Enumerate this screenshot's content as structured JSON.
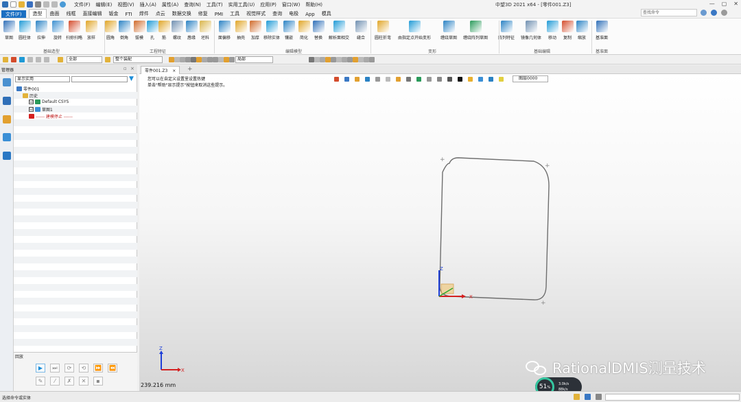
{
  "app": {
    "title": "中望3D 2021 x64 - [零件001.Z3]"
  },
  "menu": [
    "文件(F)",
    "编辑(E)",
    "视图(V)",
    "插入(A)",
    "属性(A)",
    "查询(N)",
    "工具(T)",
    "实用工具(U)",
    "应用(P)",
    "窗口(W)",
    "帮助(H)"
  ],
  "ribbon_tabs": [
    {
      "label": "文件(F)",
      "kind": "file"
    },
    {
      "label": "造型",
      "kind": "active"
    },
    {
      "label": "曲面"
    },
    {
      "label": "线框"
    },
    {
      "label": "直接编辑"
    },
    {
      "label": "钣金"
    },
    {
      "label": "FTI"
    },
    {
      "label": "焊件"
    },
    {
      "label": "点云"
    },
    {
      "label": "数据交换"
    },
    {
      "label": "修复"
    },
    {
      "label": "PMI"
    },
    {
      "label": "工具"
    },
    {
      "label": "视觉样式"
    },
    {
      "label": "查询"
    },
    {
      "label": "电极"
    },
    {
      "label": "App"
    },
    {
      "label": "模具"
    }
  ],
  "search": {
    "placeholder": "查找命令"
  },
  "ribbon": {
    "tools": [
      {
        "label": "草图",
        "color": "#2f6fb8"
      },
      {
        "label": "圆柱体",
        "color": "#1f9ad6"
      },
      {
        "label": "拉伸",
        "color": "#2a82c4"
      },
      {
        "label": "旋转",
        "color": "#3c8fd0"
      },
      {
        "label": "扫掠扫略",
        "color": "#d44c2c"
      },
      {
        "label": "放样",
        "color": "#e0a526"
      },
      {
        "label": "圆角",
        "color": "#e0a526"
      },
      {
        "label": "倒角",
        "color": "#2a82c4"
      },
      {
        "label": "拔模",
        "color": "#d06a2a"
      },
      {
        "label": "孔",
        "color": "#1f9ad6"
      },
      {
        "label": "筋",
        "color": "#e0a526"
      },
      {
        "label": "螺纹",
        "color": "#6f8fb0"
      },
      {
        "label": "唇缘",
        "color": "#2a82c4"
      },
      {
        "label": "坯料",
        "color": "#d9b54a"
      },
      {
        "label": "面偏移",
        "color": "#2a82c4"
      },
      {
        "label": "抽壳",
        "color": "#e0a526"
      },
      {
        "label": "加厚",
        "color": "#d06a2a"
      },
      {
        "label": "移除实体",
        "color": "#1f9ad6"
      },
      {
        "label": "镶嵌",
        "color": "#2a82c4"
      },
      {
        "label": "简化",
        "color": "#e0a526"
      },
      {
        "label": "替换",
        "color": "#2f6fb8"
      },
      {
        "label": "解析面相交",
        "color": "#1f9ad6"
      },
      {
        "label": "缝合",
        "color": "#6f8fb0"
      },
      {
        "label": "圆柱折弯",
        "color": "#e0a526"
      },
      {
        "label": "由指定点开始变形",
        "color": "#1f9ad6"
      },
      {
        "label": "缠绕草图",
        "color": "#2a82c4"
      },
      {
        "label": "缠绕阵列草图",
        "color": "#2a9a5a"
      },
      {
        "label": "阵列特征",
        "color": "#2a82c4"
      },
      {
        "label": "镜像几何体",
        "color": "#6f8fb0"
      },
      {
        "label": "移动",
        "color": "#1f9ad6"
      },
      {
        "label": "复制",
        "color": "#d44c2c"
      },
      {
        "label": "缩放",
        "color": "#2a82c4"
      },
      {
        "label": "基准面",
        "color": "#2f6fb8"
      }
    ],
    "groups": [
      "基础造型",
      "工程特征",
      "编辑模型",
      "变形",
      "基础编辑",
      "基准面"
    ]
  },
  "toolbar2": {
    "filter_all": "全部",
    "filter_scope": "整个装配",
    "view_combo": "局部"
  },
  "manager": {
    "title": "管理器",
    "filter": "显示实用",
    "tree": [
      {
        "label": "零件001",
        "level": 0,
        "check": "",
        "icon": "part"
      },
      {
        "label": "历史",
        "level": 1,
        "check": "",
        "icon": "folder"
      },
      {
        "label": "Default CSYS",
        "level": 2,
        "check": "☑",
        "icon": "csys"
      },
      {
        "label": "草图1",
        "level": 2,
        "check": "☑",
        "icon": "sketch"
      },
      {
        "label": "------ 建模停止 ------",
        "level": 2,
        "check": "",
        "icon": "stop"
      }
    ]
  },
  "rollback": {
    "title": "回放",
    "buttons": [
      "▶",
      "⏭",
      "⟳",
      "⟲",
      "⏩",
      "⏪",
      "✎",
      "⁄",
      "✗",
      "✕",
      "▪"
    ]
  },
  "document": {
    "tab": "零件001.Z3",
    "close": "×",
    "new_tab": "+"
  },
  "viewport": {
    "hints": [
      "您可以在自定义设置里设置热键",
      "单击\"帮助\"显示提示\"按钮来取消这些提示。"
    ],
    "layer": "图层0000",
    "measure": "239.216 mm",
    "axis_x": "X",
    "axis_y": "Y",
    "axis_z": "Z",
    "watermark": "RationalDMIS测量技术",
    "perf_pct": "51",
    "perf_pct_unit": "%",
    "perf_up": "3.0k/s",
    "perf_down": "88k/s"
  },
  "status": {
    "text": "选择命令或实体"
  },
  "colors": {
    "accent": "#1b6fc2",
    "sketch_stroke": "#6e6e6e",
    "axis_x": "#d42020",
    "axis_y": "#2ea82e",
    "axis_z": "#1e3fd8"
  }
}
